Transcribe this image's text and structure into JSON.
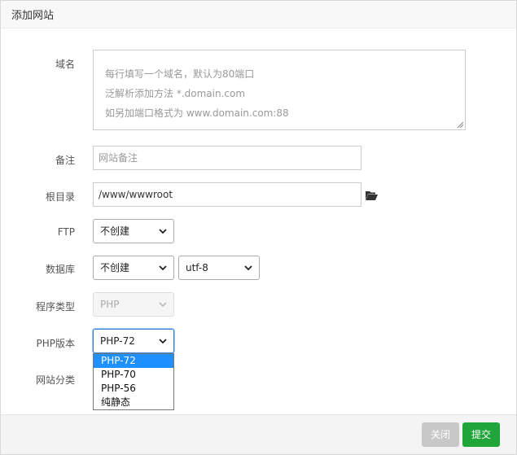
{
  "dialog": {
    "title": "添加网站"
  },
  "domain": {
    "label": "域名",
    "placeholder_lines": [
      "每行填写一个域名，默认为80端口",
      "泛解析添加方法 *.domain.com",
      "如另加端口格式为 www.domain.com:88"
    ]
  },
  "note": {
    "label": "备注",
    "placeholder": "网站备注"
  },
  "root": {
    "label": "根目录",
    "value": "/www/wwwroot"
  },
  "ftp": {
    "label": "FTP",
    "value": "不创建"
  },
  "database": {
    "label": "数据库",
    "value": "不创建",
    "charset": "utf-8"
  },
  "program": {
    "label": "程序类型",
    "value": "PHP"
  },
  "php": {
    "label": "PHP版本",
    "value": "PHP-72",
    "options": [
      "PHP-72",
      "PHP-70",
      "PHP-56",
      "纯静态"
    ]
  },
  "category": {
    "label": "网站分类"
  },
  "footer": {
    "close_label": "关闭",
    "submit_label": "提交"
  },
  "colors": {
    "submit": "#20a53a",
    "close": "#c8c8c8",
    "selected_option": "#1e90ff"
  }
}
